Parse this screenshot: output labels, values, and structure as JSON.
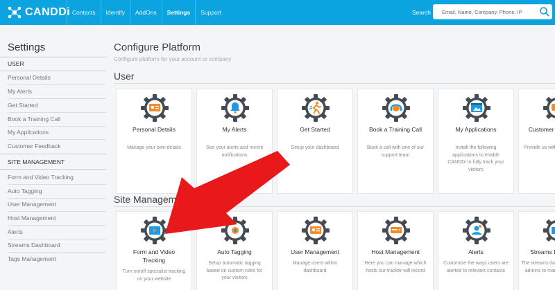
{
  "app": {
    "logo_text": "CANDDi",
    "nav": [
      "Contacts",
      "Identify",
      "AddOns",
      "Settings",
      "Support"
    ],
    "active_nav": "Settings",
    "search_label": "Search",
    "search_placeholder": "Email, Name, Company, Phone, IP"
  },
  "sidebar": {
    "title": "Settings",
    "user_heading": "USER",
    "user_items": [
      "Personal Details",
      "My Alerts",
      "Get Started",
      "Book a Training Call",
      "My Applications",
      "Customer Feedback"
    ],
    "site_heading": "SITE MANAGEMENT",
    "site_items": [
      "Form and Video Tracking",
      "Auto Tagging",
      "User Management",
      "Host Management",
      "Alerts",
      "Streams Dashboard",
      "Tags Management"
    ]
  },
  "main": {
    "title": "Configure Platform",
    "subtitle": "Configure platform for your account or company",
    "user_section": "User",
    "site_section": "Site Management",
    "user_cards": [
      {
        "title": "Personal Details",
        "desc": "Manage your own details",
        "icon": "id-card-icon"
      },
      {
        "title": "My Alerts",
        "desc": "See your alerts and recent notifications",
        "icon": "bell-icon"
      },
      {
        "title": "Get Started",
        "desc": "Setup your dashboard",
        "icon": "runner-icon"
      },
      {
        "title": "Book a Training Call",
        "desc": "Book a call with one of our support team",
        "icon": "headset-icon"
      },
      {
        "title": "My Applications",
        "desc": "Install the following applications to enable CANDDi to fully track your visitors",
        "icon": "app-window-icon"
      },
      {
        "title": "Customer Feedback",
        "desc": "Provide us with feedback, ...",
        "icon": "feedback-icon"
      }
    ],
    "site_cards": [
      {
        "title": "Form and Video Tracking",
        "desc": "Turn on/off specialist tracking on your website",
        "icon": "video-form-icon"
      },
      {
        "title": "Auto Tagging",
        "desc": "Setup automatic tagging based on custom rules for your visitors",
        "icon": "tag-gear-icon"
      },
      {
        "title": "User Management",
        "desc": "Manage users within dashboard",
        "icon": "users-icon"
      },
      {
        "title": "Host Management",
        "desc": "Here you can manage which hosts our tracker will record",
        "icon": "server-icon"
      },
      {
        "title": "Alerts",
        "desc": "Customise the ways users are alerted to relevant contacts",
        "icon": "alert-person-icon"
      },
      {
        "title": "Streams Dashboard",
        "desc": "The streams dashboard allows admins to manage streams",
        "icon": "streams-icon"
      }
    ]
  },
  "colors": {
    "topbar": "#0ba3e0",
    "arrow": "#e8191b",
    "gear": "#444b52",
    "accent_orange": "#f28c28",
    "accent_blue": "#1e9be6"
  }
}
